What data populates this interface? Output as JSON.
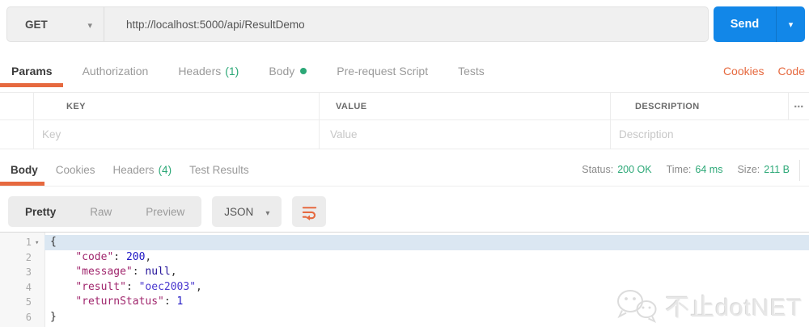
{
  "colors": {
    "accent_orange": "#e6693f",
    "send_blue": "#1287e8",
    "success_green": "#2ca877",
    "syntax_key": "#a0266d",
    "syntax_number": "#1f16c4",
    "syntax_string": "#4a38cf",
    "syntax_null": "#221199",
    "line_highlight": "#dbe7f2"
  },
  "request": {
    "method": "GET",
    "url": "http://localhost:5000/api/ResultDemo",
    "send_label": "Send",
    "cookies_label": "Cookies",
    "code_label": "Code",
    "tabs": [
      {
        "label": "Params",
        "active": true
      },
      {
        "label": "Authorization"
      },
      {
        "label": "Headers",
        "count": "(1)"
      },
      {
        "label": "Body",
        "dot": true
      },
      {
        "label": "Pre-request Script"
      },
      {
        "label": "Tests"
      }
    ]
  },
  "params_table": {
    "columns": [
      "KEY",
      "VALUE",
      "DESCRIPTION"
    ],
    "row_placeholders": [
      "Key",
      "Value",
      "Description"
    ]
  },
  "response": {
    "tabs": [
      {
        "label": "Body",
        "active": true
      },
      {
        "label": "Cookies"
      },
      {
        "label": "Headers",
        "count": "(4)"
      },
      {
        "label": "Test Results"
      }
    ],
    "meta": [
      {
        "label": "Status:",
        "value": "200 OK"
      },
      {
        "label": "Time:",
        "value": "64 ms"
      },
      {
        "label": "Size:",
        "value": "211 B"
      }
    ],
    "view_modes": [
      {
        "label": "Pretty",
        "active": true
      },
      {
        "label": "Raw"
      },
      {
        "label": "Preview"
      }
    ],
    "format": "JSON"
  },
  "response_body": {
    "lines": [
      {
        "num": "1",
        "fold": true,
        "highlight": true,
        "indent": 0,
        "tokens": [
          [
            "p",
            "{"
          ]
        ]
      },
      {
        "num": "2",
        "indent": 1,
        "tokens": [
          [
            "k",
            "\"code\""
          ],
          [
            "p",
            ": "
          ],
          [
            "n",
            "200"
          ],
          [
            "p",
            ","
          ]
        ]
      },
      {
        "num": "3",
        "indent": 1,
        "tokens": [
          [
            "k",
            "\"message\""
          ],
          [
            "p",
            ": "
          ],
          [
            "a",
            "null"
          ],
          [
            "p",
            ","
          ]
        ]
      },
      {
        "num": "4",
        "indent": 1,
        "tokens": [
          [
            "k",
            "\"result\""
          ],
          [
            "p",
            ": "
          ],
          [
            "s",
            "\"oec2003\""
          ],
          [
            "p",
            ","
          ]
        ]
      },
      {
        "num": "5",
        "indent": 1,
        "tokens": [
          [
            "k",
            "\"returnStatus\""
          ],
          [
            "p",
            ": "
          ],
          [
            "n",
            "1"
          ]
        ]
      },
      {
        "num": "6",
        "indent": 0,
        "tokens": [
          [
            "p",
            "}"
          ]
        ]
      }
    ]
  },
  "watermark": {
    "text": "不止dotNET"
  }
}
